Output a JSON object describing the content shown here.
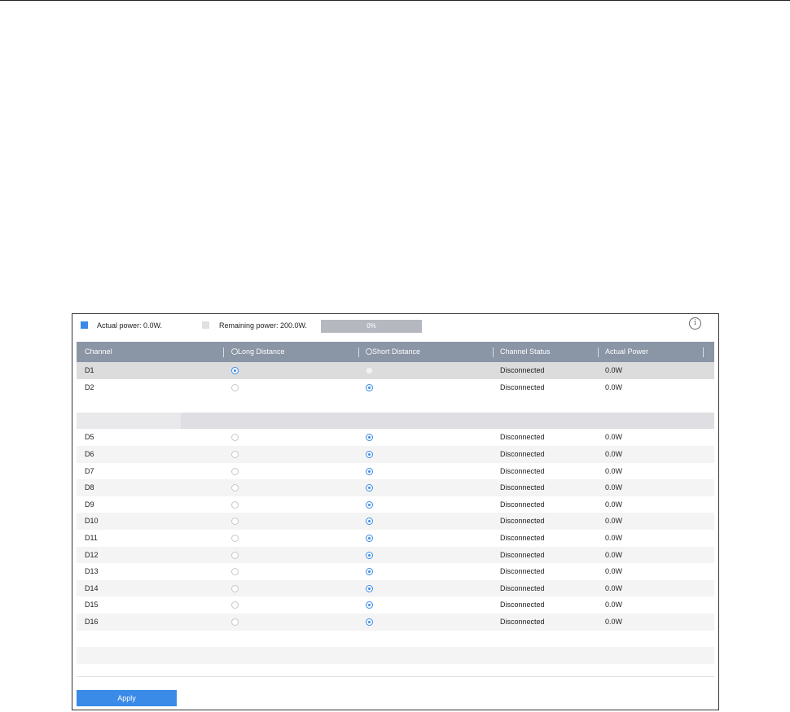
{
  "power": {
    "actual_label": "Actual power: 0.0W.",
    "remaining_label": "Remaining power: 200.0W.",
    "progress_percent_text": "0%",
    "progress_fraction": 0.0,
    "info_glyph": "i"
  },
  "table": {
    "headers": {
      "channel": "Channel",
      "long": "Long Distance",
      "short": "Short Distance",
      "status": "Channel Status",
      "power": "Actual Power"
    },
    "rows_top": [
      {
        "channel": "D1",
        "mode": "long",
        "status": "Disconnected",
        "power": "0.0W"
      },
      {
        "channel": "D2",
        "mode": "short",
        "status": "Disconnected",
        "power": "0.0W"
      }
    ],
    "rows_main": [
      {
        "channel": "D5",
        "mode": "short",
        "status": "Disconnected",
        "power": "0.0W"
      },
      {
        "channel": "D6",
        "mode": "short",
        "status": "Disconnected",
        "power": "0.0W"
      },
      {
        "channel": "D7",
        "mode": "short",
        "status": "Disconnected",
        "power": "0.0W"
      },
      {
        "channel": "D8",
        "mode": "short",
        "status": "Disconnected",
        "power": "0.0W"
      },
      {
        "channel": "D9",
        "mode": "short",
        "status": "Disconnected",
        "power": "0.0W"
      },
      {
        "channel": "D10",
        "mode": "short",
        "status": "Disconnected",
        "power": "0.0W"
      },
      {
        "channel": "D11",
        "mode": "short",
        "status": "Disconnected",
        "power": "0.0W"
      },
      {
        "channel": "D12",
        "mode": "short",
        "status": "Disconnected",
        "power": "0.0W"
      },
      {
        "channel": "D13",
        "mode": "short",
        "status": "Disconnected",
        "power": "0.0W"
      },
      {
        "channel": "D14",
        "mode": "short",
        "status": "Disconnected",
        "power": "0.0W"
      },
      {
        "channel": "D15",
        "mode": "short",
        "status": "Disconnected",
        "power": "0.0W"
      },
      {
        "channel": "D16",
        "mode": "short",
        "status": "Disconnected",
        "power": "0.0W"
      }
    ]
  },
  "apply_label": "Apply",
  "colors": {
    "accent": "#3a8ae8",
    "header_bg": "#8a95a5",
    "remaining_swatch": "#e0e0e0"
  }
}
